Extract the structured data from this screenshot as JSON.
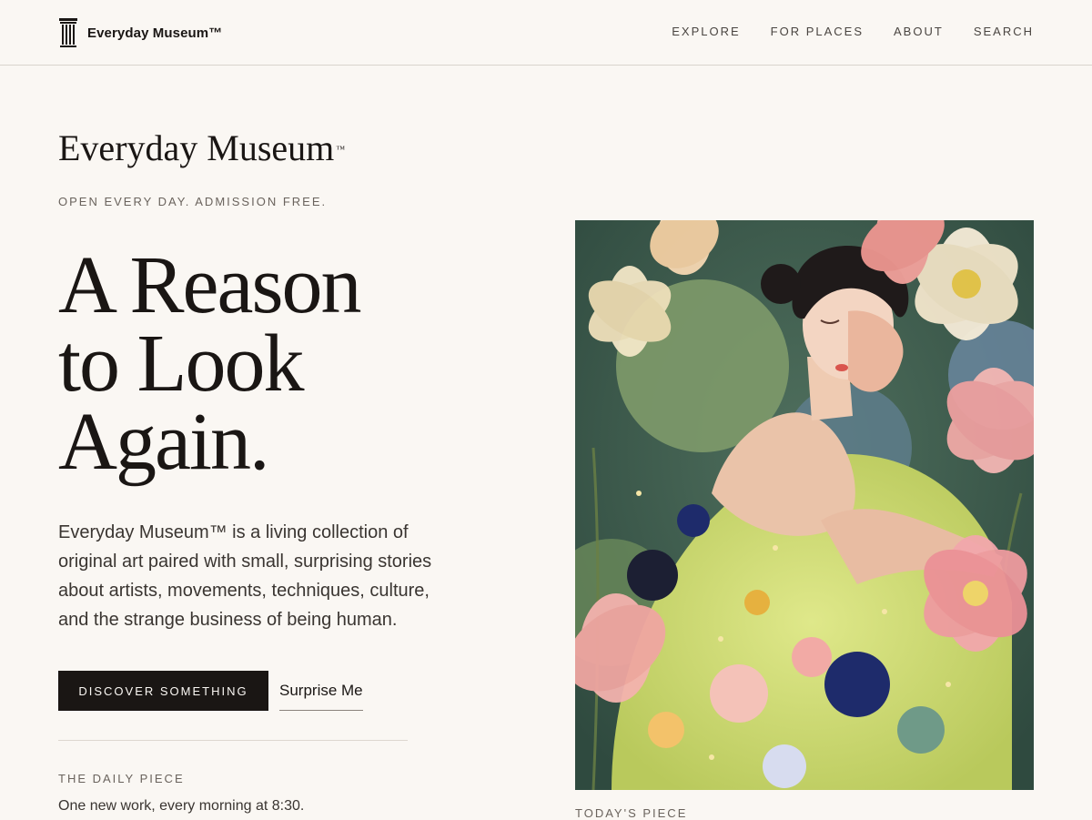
{
  "header": {
    "brand": "Everyday Museum™",
    "nav": [
      "EXPLORE",
      "FOR PLACES",
      "ABOUT",
      "SEARCH"
    ]
  },
  "hero": {
    "site_title": "Everyday Museum",
    "tm": "™",
    "tagline": "OPEN EVERY DAY. ADMISSION FREE.",
    "headline": [
      "A Reason",
      "to Look",
      "Again."
    ],
    "intro": "Everyday Museum™ is a living collection of original art paired with small, surprising stories about artists, movements, techniques, culture, and the strange business of being human.",
    "primary_cta": "DISCOVER SOMETHING",
    "secondary_cta": "Surprise Me",
    "daily_label": "THE DAILY PIECE",
    "daily_text": "One new work, every morning at 8:30."
  },
  "featured": {
    "caption": "TODAY'S PIECE"
  },
  "colors": {
    "background": "#faf7f3",
    "ink": "#1a1614",
    "muted": "#6a635d",
    "divider": "#d9d4cd"
  }
}
